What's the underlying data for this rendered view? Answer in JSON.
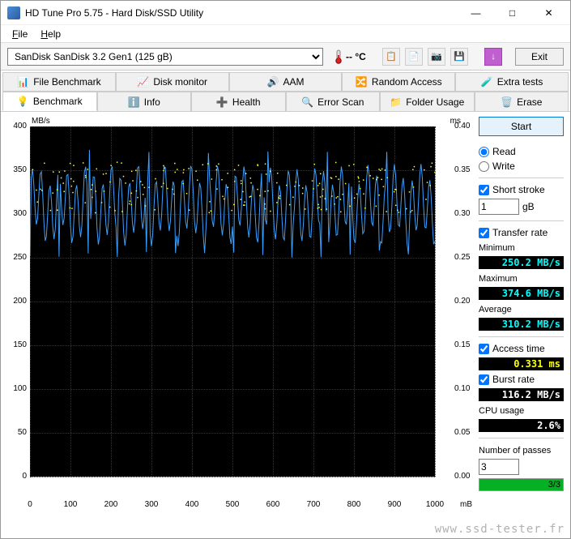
{
  "window": {
    "title": "HD Tune Pro 5.75 - Hard Disk/SSD Utility"
  },
  "menubar": {
    "file": "File",
    "help": "Help"
  },
  "toolbar": {
    "drive": "SanDisk SanDisk 3.2 Gen1 (125 gB)",
    "temp": "-- °C",
    "exit": "Exit"
  },
  "tabs_top": [
    "File Benchmark",
    "Disk monitor",
    "AAM",
    "Random Access",
    "Extra tests"
  ],
  "tabs_bottom": [
    "Benchmark",
    "Info",
    "Health",
    "Error Scan",
    "Folder Usage",
    "Erase"
  ],
  "active_tab": "Benchmark",
  "controls": {
    "start": "Start",
    "read": "Read",
    "write": "Write",
    "short_stroke": "Short stroke",
    "short_stroke_val": "1",
    "short_stroke_unit": "gB",
    "transfer_rate": "Transfer rate",
    "minimum_label": "Minimum",
    "minimum_value": "250.2 MB/s",
    "maximum_label": "Maximum",
    "maximum_value": "374.6 MB/s",
    "average_label": "Average",
    "average_value": "310.2 MB/s",
    "access_time_label": "Access time",
    "access_time_value": "0.331 ms",
    "burst_rate_label": "Burst rate",
    "burst_rate_value": "116.2 MB/s",
    "cpu_usage_label": "CPU usage",
    "cpu_usage_value": "2.6%",
    "passes_label": "Number of passes",
    "passes_value": "3",
    "progress_text": "3/3"
  },
  "chart_data": {
    "type": "line",
    "x_unit": "mB",
    "y_left_label": "MB/s",
    "y_right_label": "ms",
    "xlim": [
      0,
      1000
    ],
    "ylim_left": [
      0,
      400
    ],
    "ylim_right": [
      0,
      0.4
    ],
    "ticks_left": [
      0,
      50,
      100,
      150,
      200,
      250,
      300,
      350,
      400
    ],
    "ticks_right": [
      0.0,
      0.05,
      0.1,
      0.15,
      0.2,
      0.25,
      0.3,
      0.35,
      0.4
    ],
    "ticks_bottom": [
      0,
      100,
      200,
      300,
      400,
      500,
      600,
      700,
      800,
      900,
      1000
    ],
    "series": [
      {
        "name": "Transfer rate (MB/s)",
        "color": "#3aa0ff",
        "min": 250.2,
        "max": 374.6,
        "avg": 310.2,
        "style": "oscillating-line"
      },
      {
        "name": "Access time (ms)",
        "color": "#ffff40",
        "avg": 0.331,
        "min": 0.28,
        "max": 0.37,
        "style": "scatter"
      }
    ]
  },
  "watermark": "www.ssd-tester.fr"
}
